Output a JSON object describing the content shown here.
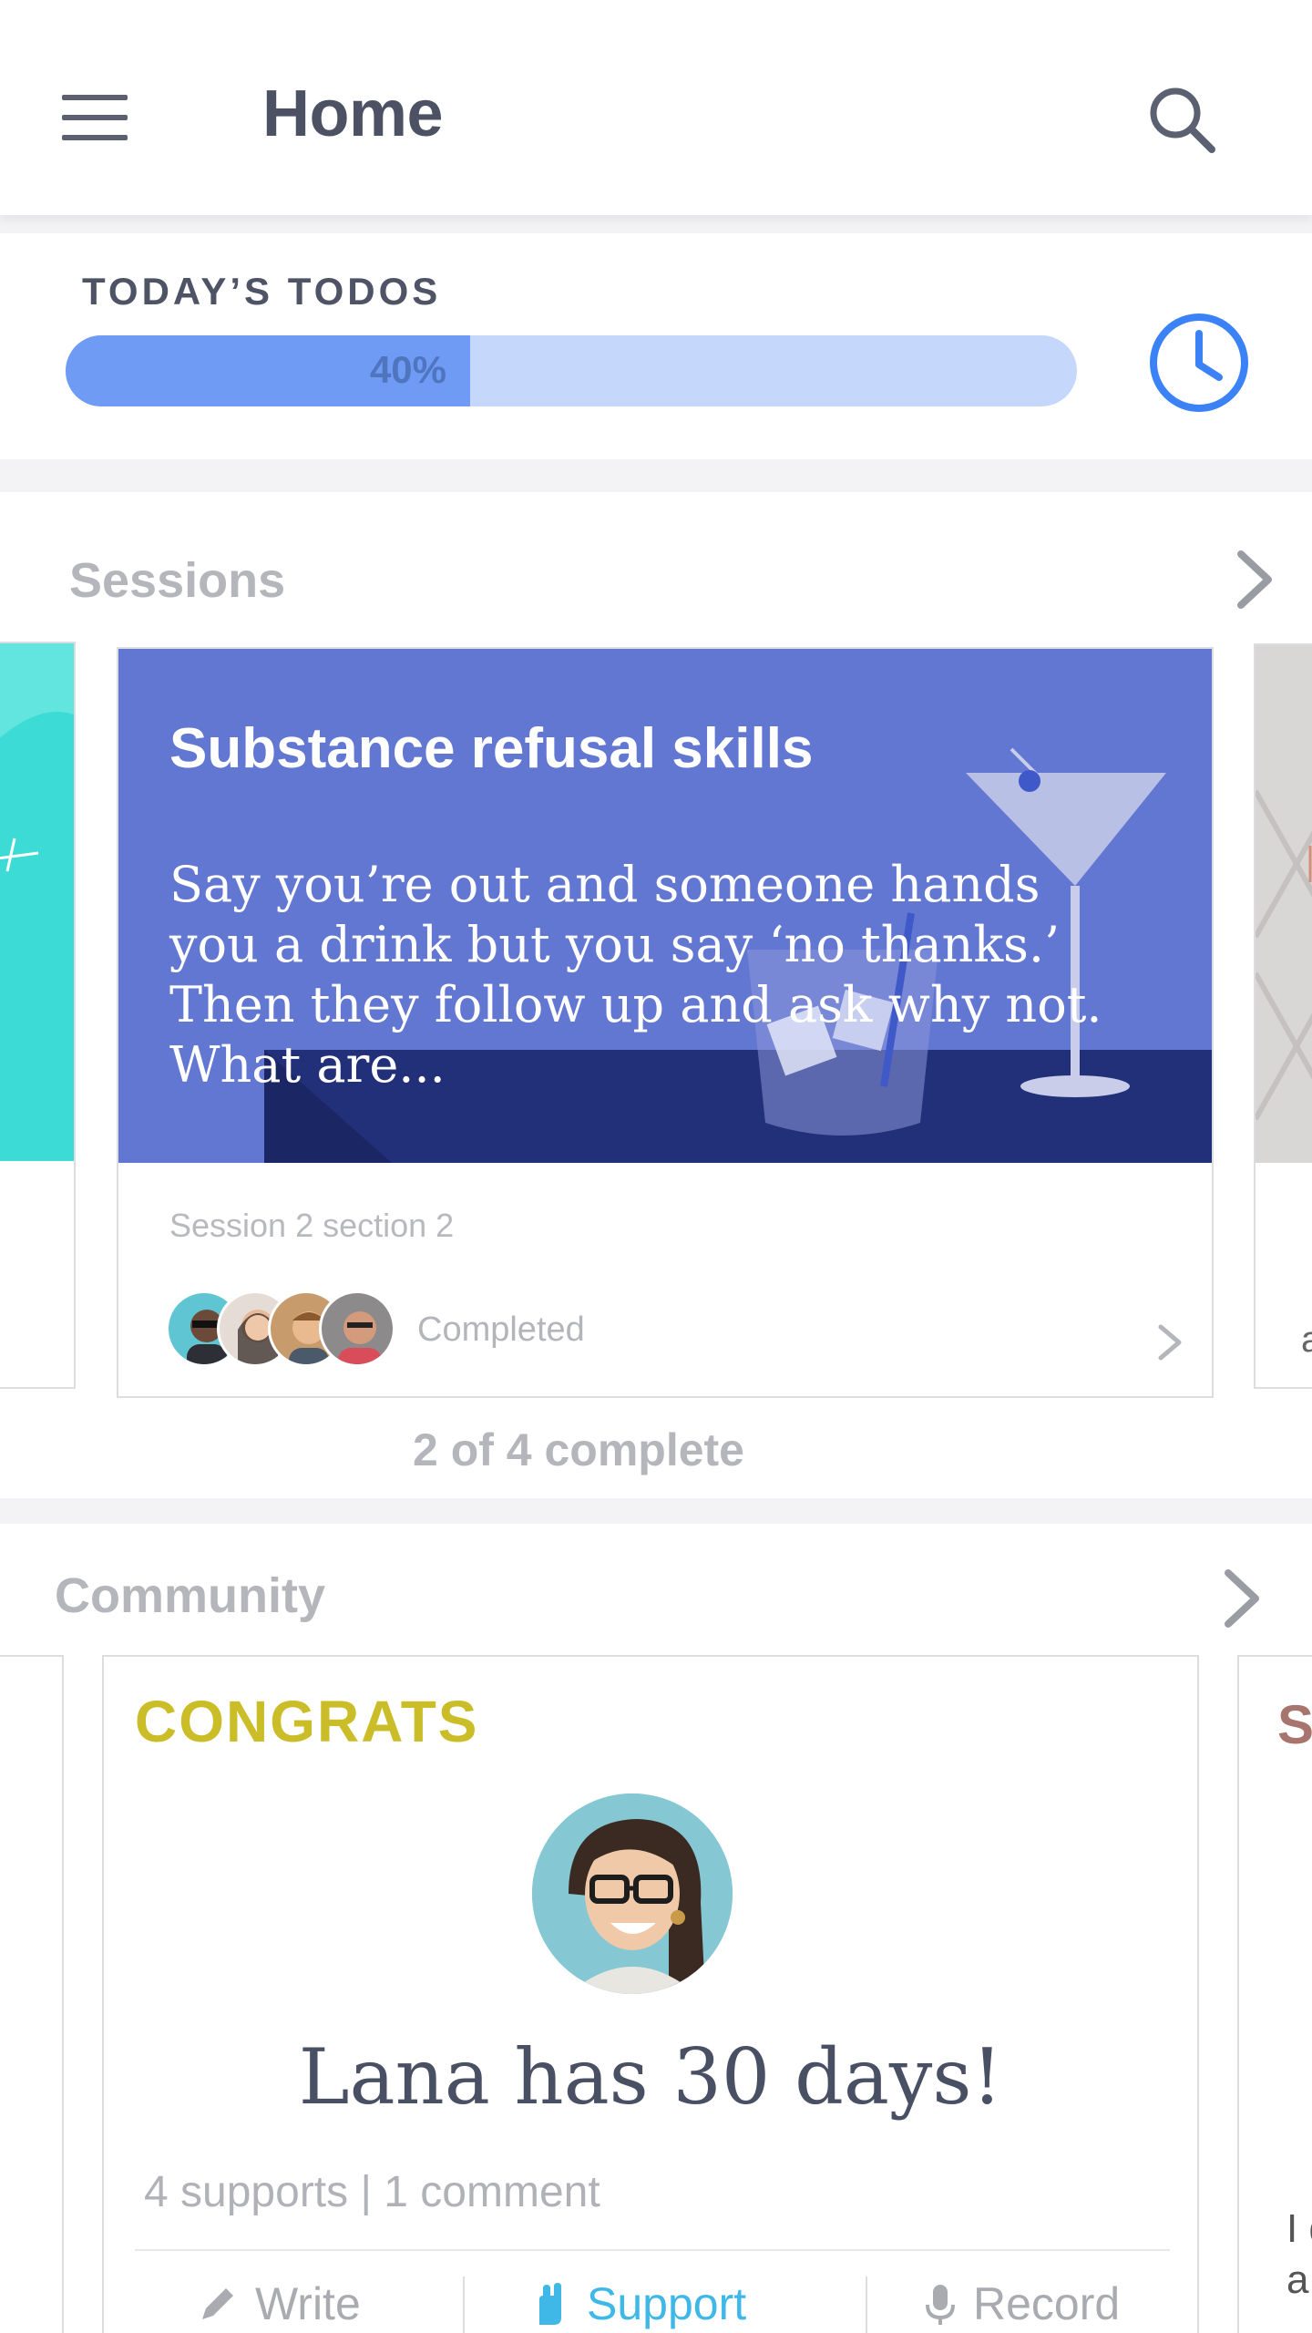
{
  "header": {
    "title": "Home",
    "menu_icon": "hamburger-menu-icon",
    "search_icon": "search-icon"
  },
  "todos": {
    "title": "TODAY’S TODOS",
    "progress": 0.4,
    "progress_label": "40%",
    "clock_icon": "clock-icon"
  },
  "sessions": {
    "title": "Sessions",
    "card": {
      "title": "Substance refusal skills",
      "description": "Say you’re out and someone hands you a drink but you say ‘no thanks.’ Then they follow up and ask why not. What are...",
      "meta": "Session 2 section 2",
      "status": "Completed"
    },
    "peek_right_letter": "a",
    "count": "2 of 4 complete"
  },
  "community": {
    "title": "Community",
    "card": {
      "tag": "CONGRATS",
      "headline": "Lana has 30 days!",
      "stats": "4 supports | 1 comment",
      "actions": [
        {
          "label": "Write",
          "icon": "pencil-icon"
        },
        {
          "label": "Support",
          "icon": "raised-hand-icon"
        },
        {
          "label": "Record",
          "icon": "microphone-icon"
        }
      ]
    },
    "peek_right_letter": "S",
    "peek_right_text": "I d a"
  },
  "colors": {
    "accent_blue": "#3b82f6",
    "progress_fill": "#6f9bf5",
    "progress_track": "#c5d7fb",
    "card_hero": "#6277d2",
    "congrats": "#cabd28",
    "support_active": "#3fb8e8"
  }
}
